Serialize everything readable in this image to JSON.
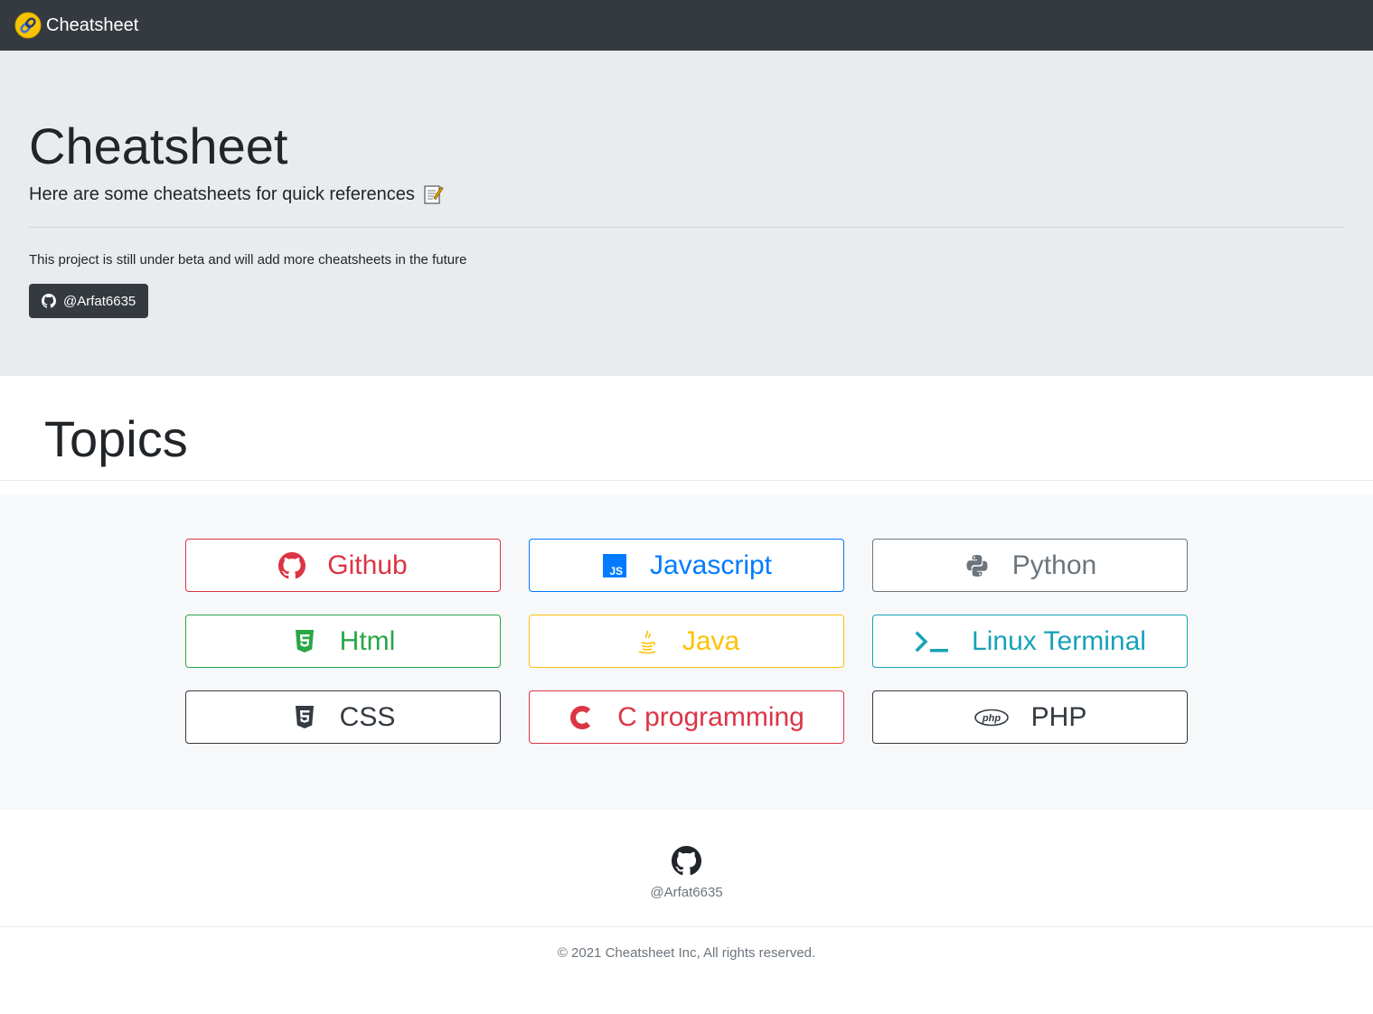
{
  "nav": {
    "brand": "Cheatsheet"
  },
  "hero": {
    "title": "Cheatsheet",
    "lead": "Here are some cheatsheets for quick references",
    "text": "This project is still under beta and will add more cheatsheets in the future",
    "button_label": "@Arfat6635"
  },
  "topics": {
    "title": "Topics",
    "items": [
      {
        "label": "Github",
        "icon": "github-icon",
        "color": "#dc3545"
      },
      {
        "label": "Javascript",
        "icon": "js-icon",
        "color": "#007bff"
      },
      {
        "label": "Python",
        "icon": "python-icon",
        "color": "#6c757d"
      },
      {
        "label": "Html",
        "icon": "html5-icon",
        "color": "#28a745"
      },
      {
        "label": "Java",
        "icon": "java-icon",
        "color": "#ffc107"
      },
      {
        "label": "Linux Terminal",
        "icon": "terminal-icon",
        "color": "#17a2b8"
      },
      {
        "label": "CSS",
        "icon": "css3-icon",
        "color": "#343a40"
      },
      {
        "label": "C programming",
        "icon": "c-icon",
        "color": "#dc3545"
      },
      {
        "label": "PHP",
        "icon": "php-icon",
        "color": "#343a40"
      }
    ]
  },
  "footer": {
    "username": "@Arfat6635",
    "copyright": "© 2021 Cheatsheet Inc, All rights reserved."
  }
}
